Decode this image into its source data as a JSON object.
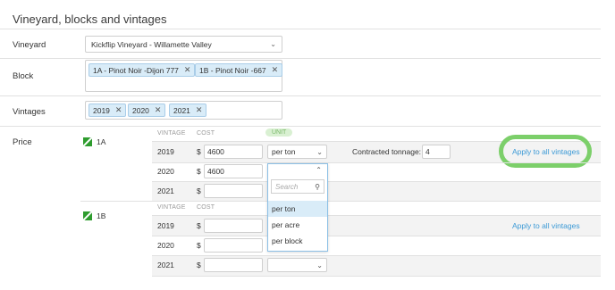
{
  "section_title": "Vineyard, blocks and vintages",
  "vineyard": {
    "label": "Vineyard",
    "value": "Kickflip Vineyard - Willamette Valley"
  },
  "block": {
    "label": "Block",
    "tags": [
      "1A - Pinot Noir -Dijon 777",
      "1B - Pinot Noir -667"
    ]
  },
  "vintages": {
    "label": "Vintages",
    "tags": [
      "2019",
      "2020",
      "2021"
    ]
  },
  "price": {
    "label": "Price",
    "headers": {
      "vintage": "VINTAGE",
      "cost": "COST",
      "unit": "UNIT"
    },
    "currency": "$",
    "blocks": [
      {
        "name": "1A",
        "rows": [
          {
            "year": "2019",
            "cost": "4600",
            "unit": "per ton"
          },
          {
            "year": "2020",
            "cost": "4600",
            "unit": ""
          },
          {
            "year": "2021",
            "cost": "",
            "unit": ""
          }
        ],
        "contracted_label": "Contracted tonnage:",
        "contracted_value": "4",
        "apply_link": "Apply to all vintages"
      },
      {
        "name": "1B",
        "rows": [
          {
            "year": "2019",
            "cost": "",
            "unit": ""
          },
          {
            "year": "2020",
            "cost": "",
            "unit": ""
          },
          {
            "year": "2021",
            "cost": "",
            "unit": ""
          }
        ],
        "apply_link": "Apply to all vintages"
      }
    ]
  },
  "unit_dropdown": {
    "search_placeholder": "Search",
    "options": [
      "per ton",
      "per acre",
      "per block"
    ],
    "highlighted": "per ton"
  },
  "icons": {
    "chevron": "chevron-down-icon",
    "close": "close-icon",
    "search": "search-icon",
    "block": "block-status-icon"
  },
  "colors": {
    "tag_bg": "#d9ecf8",
    "link": "#3c9ad6",
    "highlight_ring": "#7ccf6a",
    "block_icon": "#2e9c2e"
  }
}
